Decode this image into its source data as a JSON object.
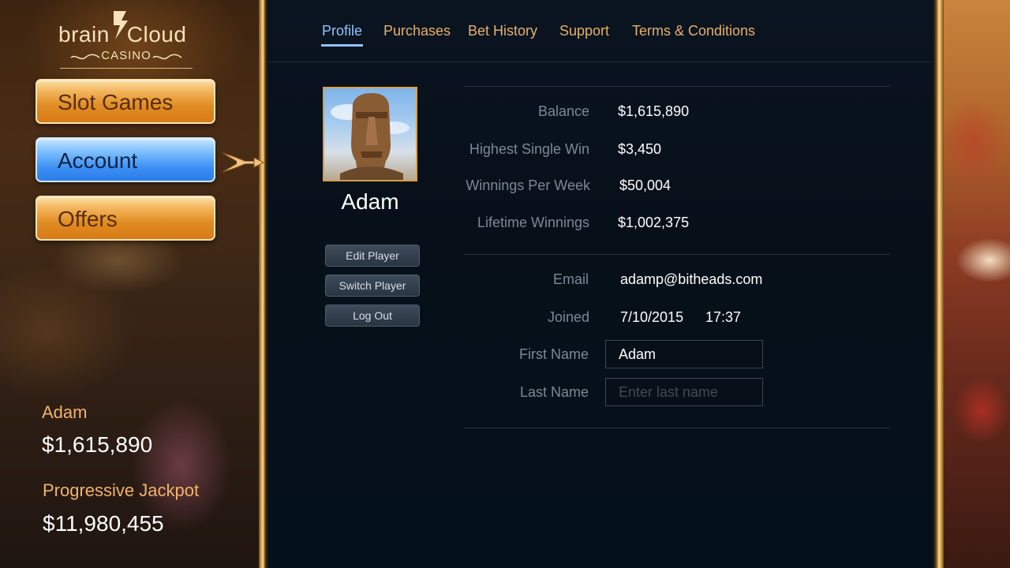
{
  "logo": {
    "brand_a": "brain",
    "brand_b": "Cloud",
    "subtitle": "CASINO"
  },
  "nav": {
    "items": [
      {
        "label": "Slot Games",
        "state": "normal"
      },
      {
        "label": "Account",
        "state": "selected"
      },
      {
        "label": "Offers",
        "state": "normal"
      }
    ]
  },
  "sidebar_info": {
    "player_name": "Adam",
    "player_balance": "$1,615,890",
    "jackpot_label": "Progressive Jackpot",
    "jackpot_value": "$11,980,455"
  },
  "tabs": [
    {
      "label": "Profile",
      "active": true
    },
    {
      "label": "Purchases",
      "active": false
    },
    {
      "label": "Bet History",
      "active": false
    },
    {
      "label": "Support",
      "active": false
    },
    {
      "label": "Terms & Conditions",
      "active": false
    }
  ],
  "profile": {
    "name": "Adam",
    "avatar_icon": "moai-statue-icon",
    "buttons": {
      "edit": "Edit Player",
      "switch": "Switch Player",
      "logout": "Log Out"
    }
  },
  "stats": [
    {
      "label": "Balance",
      "value": "$1,615,890"
    },
    {
      "label": "Highest Single Win",
      "value": "$3,450"
    },
    {
      "label": "Winnings Per Week",
      "value": "$50,004"
    },
    {
      "label": "Lifetime Winnings",
      "value": "$1,002,375"
    }
  ],
  "details": {
    "email_label": "Email",
    "email": "adamp@bitheads.com",
    "joined_label": "Joined",
    "joined_date": "7/10/2015",
    "joined_time": "17:37",
    "first_name_label": "First Name",
    "first_name_value": "Adam",
    "last_name_label": "Last Name",
    "last_name_value": "",
    "last_name_placeholder": "Enter last name"
  },
  "colors": {
    "accent_gold": "#e7b06a",
    "accent_blue": "#8ec4ff",
    "panel_bg": "#071019"
  }
}
